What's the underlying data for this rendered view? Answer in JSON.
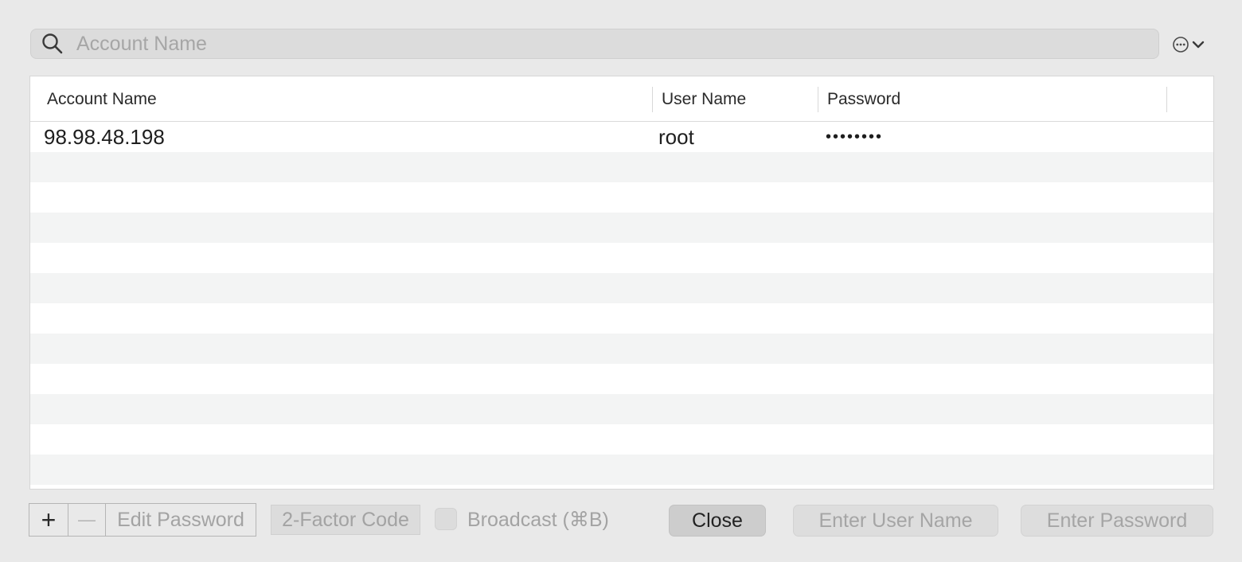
{
  "search": {
    "placeholder": "Account Name"
  },
  "toolbar": {
    "more_icon": "ellipsis-circle-icon",
    "chevron_icon": "chevron-down-icon"
  },
  "table": {
    "columns": [
      "Account Name",
      "User Name",
      "Password"
    ],
    "rows": [
      {
        "account": "98.98.48.198",
        "user": "root",
        "password": "••••••••"
      }
    ]
  },
  "bottom_bar": {
    "add_label": "+",
    "remove_label": "—",
    "edit_password_label": "Edit Password",
    "two_factor_label": "2-Factor Code",
    "broadcast_label": "Broadcast (⌘B)",
    "close_label": "Close",
    "enter_user_label": "Enter User Name",
    "enter_password_label": "Enter Password"
  }
}
